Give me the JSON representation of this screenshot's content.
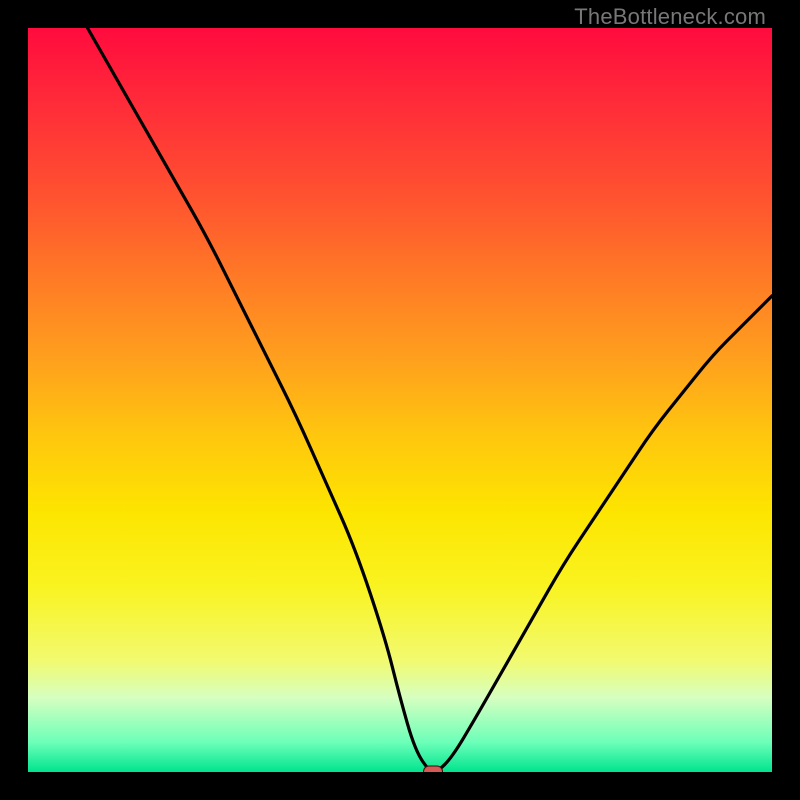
{
  "watermark": "TheBottleneck.com",
  "chart_data": {
    "type": "line",
    "title": "",
    "xlabel": "",
    "ylabel": "",
    "xlim": [
      0,
      100
    ],
    "ylim": [
      0,
      100
    ],
    "grid": false,
    "series": [
      {
        "name": "bottleneck-curve",
        "x": [
          8,
          12,
          16,
          20,
          24,
          28,
          32,
          36,
          40,
          44,
          48,
          50,
          52,
          54,
          55,
          57,
          60,
          64,
          68,
          72,
          76,
          80,
          84,
          88,
          92,
          96,
          100
        ],
        "y": [
          100,
          93,
          86,
          79,
          72,
          64,
          56,
          48,
          39,
          30,
          18,
          10,
          3,
          0,
          0,
          2,
          7,
          14,
          21,
          28,
          34,
          40,
          46,
          51,
          56,
          60,
          64
        ]
      }
    ],
    "marker": {
      "x": 54.5,
      "y": 0,
      "color": "#d45a55"
    },
    "gradient_stops": [
      {
        "pct": 0,
        "color": "#ff0b3e"
      },
      {
        "pct": 10,
        "color": "#ff2b39"
      },
      {
        "pct": 22,
        "color": "#ff5030"
      },
      {
        "pct": 33,
        "color": "#ff7826"
      },
      {
        "pct": 44,
        "color": "#ff9e1e"
      },
      {
        "pct": 55,
        "color": "#ffc70e"
      },
      {
        "pct": 65,
        "color": "#fde500"
      },
      {
        "pct": 75,
        "color": "#f9f320"
      },
      {
        "pct": 85,
        "color": "#f2fa6f"
      },
      {
        "pct": 90,
        "color": "#d6ffc0"
      },
      {
        "pct": 96,
        "color": "#6cffb9"
      },
      {
        "pct": 100,
        "color": "#00e48e"
      }
    ]
  }
}
